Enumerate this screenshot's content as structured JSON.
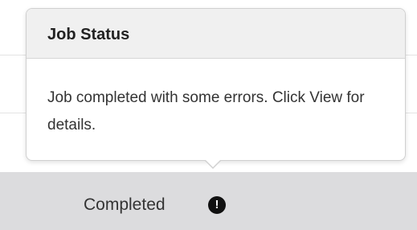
{
  "popover": {
    "title": "Job Status",
    "message": "Job completed with some errors. Click View for details."
  },
  "status_cell": {
    "label": "Completed",
    "icon": "exclamation-circle-icon",
    "icon_glyph": "!"
  },
  "colors": {
    "status_cell_bg": "#dcdcde",
    "popover_header_bg": "#f0f0f0",
    "icon_bg": "#111111"
  }
}
